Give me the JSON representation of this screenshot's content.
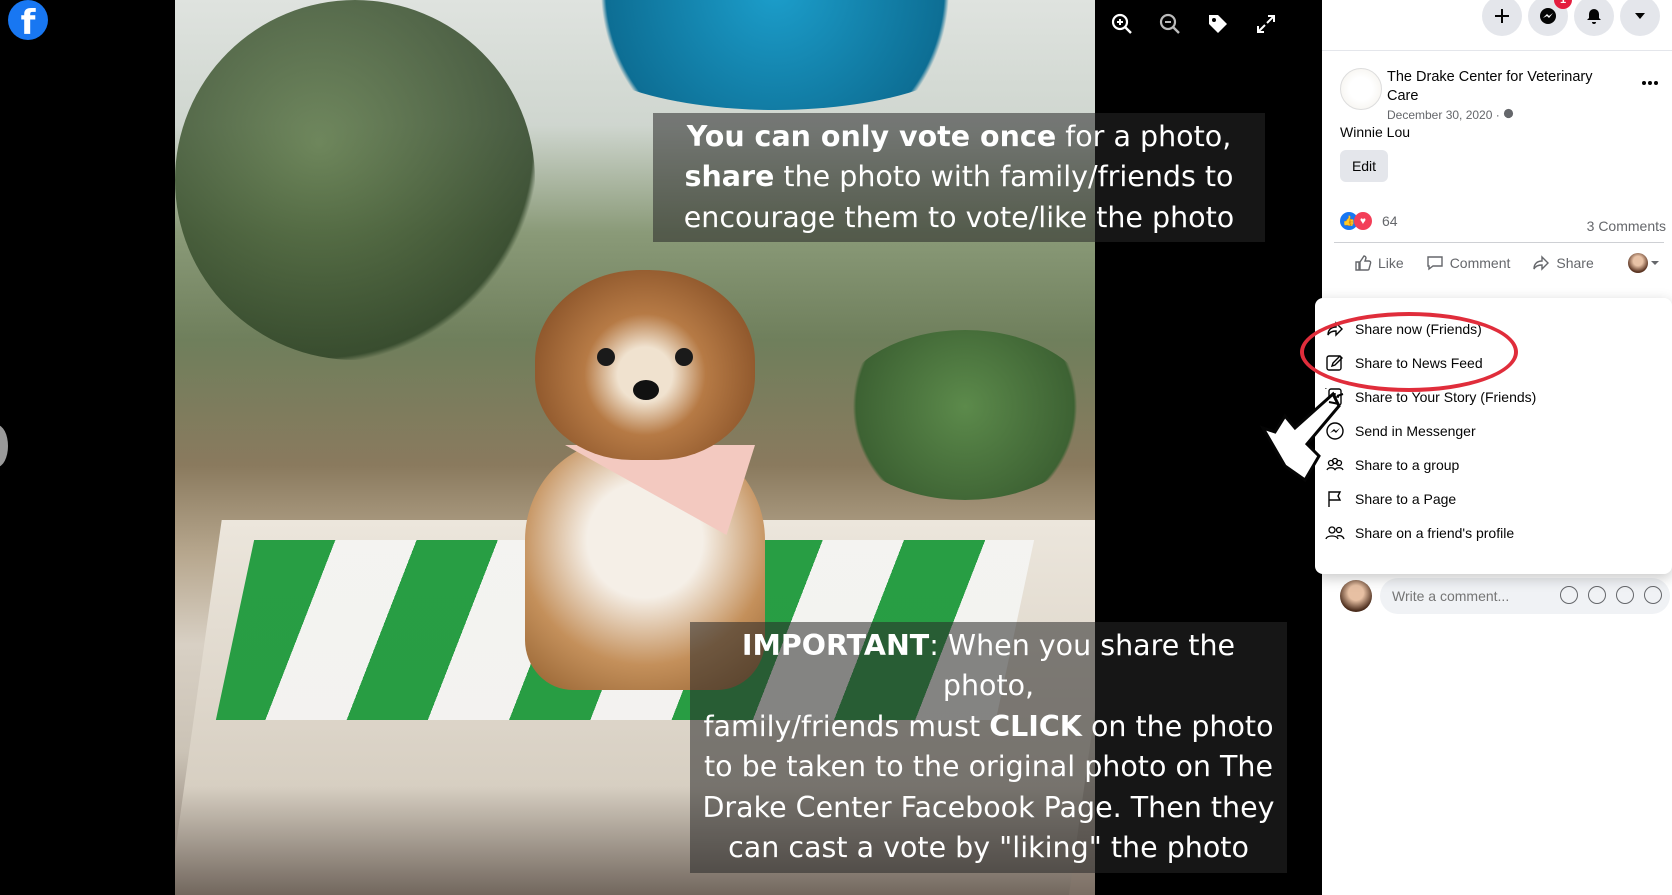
{
  "viewer": {
    "overlay_top": {
      "line1_bold": "You can only vote once",
      "line1_rest": " for a photo,",
      "line2_bold": "share",
      "line2_rest": " the photo with family/friends to",
      "line3": "encourage them to vote/like the photo"
    },
    "overlay_bottom": {
      "bold1": "IMPORTANT",
      "rest1": ": When you share the photo,",
      "line2_pre": "family/friends must ",
      "bold2": "CLICK",
      "line2_post": " on the photo",
      "line3": "to be taken to the original photo on The",
      "line4": "Drake Center Facebook Page. Then they",
      "line5": "can cast a vote by \"liking\" the photo"
    },
    "logo_letter": "f",
    "tools": [
      "zoom-in-icon",
      "zoom-out-icon",
      "tag-icon",
      "fullscreen-icon"
    ]
  },
  "topbar": {
    "buttons": [
      "plus-icon",
      "messenger-icon",
      "notifications-icon",
      "account-menu-icon"
    ],
    "messenger_badge": "1"
  },
  "post": {
    "page_name": "The Drake Center for Veterinary Care",
    "date": "December 30, 2020 ·",
    "caption": "Winnie Lou",
    "edit_label": "Edit",
    "reaction_count": "64",
    "comment_count": "3 Comments",
    "actions": {
      "like": "Like",
      "comment": "Comment",
      "share": "Share"
    }
  },
  "share_menu": {
    "items": [
      {
        "label": "Share now (Friends)",
        "icon": "share-arrow-icon"
      },
      {
        "label": "Share to News Feed",
        "icon": "edit-pencil-icon"
      },
      {
        "label": "Share to Your Story (Friends)",
        "icon": "story-icon"
      },
      {
        "label": "Send in Messenger",
        "icon": "messenger-icon"
      },
      {
        "label": "Share to a group",
        "icon": "group-icon"
      },
      {
        "label": "Share to a Page",
        "icon": "flag-icon"
      },
      {
        "label": "Share on a friend's profile",
        "icon": "friends-icon"
      }
    ]
  },
  "comment": {
    "placeholder": "Write a comment..."
  },
  "colors": {
    "fb_blue": "#1877f2",
    "annotation_red": "#e02d3b",
    "like_blue": "#1877f2",
    "love_red": "#f33e58"
  }
}
